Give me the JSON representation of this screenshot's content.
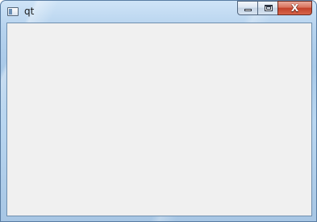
{
  "window": {
    "title": "qt",
    "icon": "qt-app-icon",
    "controls": {
      "minimize": "minimize-icon",
      "maximize": "maximize-icon",
      "close_label": "X"
    }
  },
  "colors": {
    "client_background": "#f0f0f0",
    "frame": "#b7d3ee",
    "close_button": "#c2412a"
  }
}
